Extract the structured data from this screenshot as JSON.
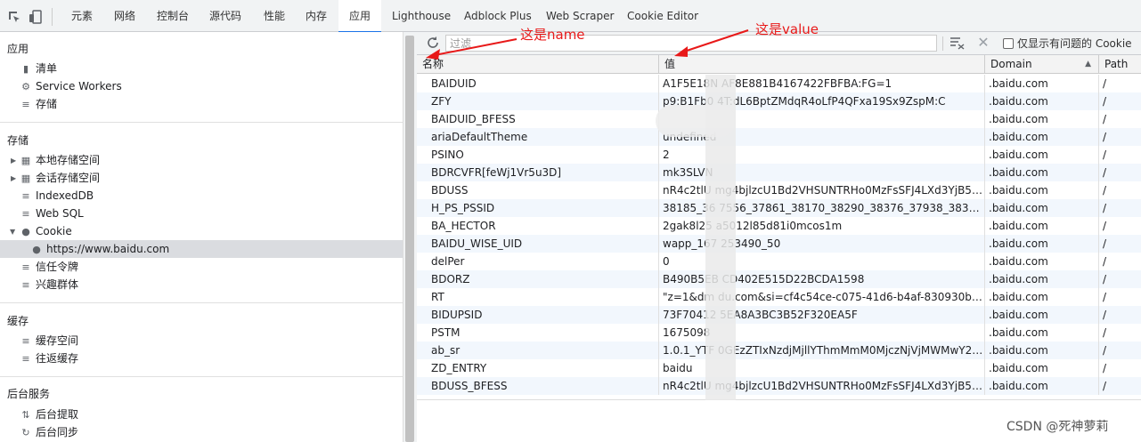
{
  "tabs": [
    {
      "label": "元素"
    },
    {
      "label": "网络"
    },
    {
      "label": "控制台"
    },
    {
      "label": "源代码"
    },
    {
      "label": "性能"
    },
    {
      "label": "内存"
    },
    {
      "label": "应用"
    },
    {
      "label": "Lighthouse"
    },
    {
      "label": "Adblock Plus"
    },
    {
      "label": "Web Scraper"
    },
    {
      "label": "Cookie Editor"
    }
  ],
  "sidebar": {
    "app_title": "应用",
    "app_items": [
      "清单",
      "Service Workers",
      "存储"
    ],
    "storage_title": "存储",
    "storage_items": [
      "本地存储空间",
      "会话存储空间",
      "IndexedDB",
      "Web SQL",
      "Cookie"
    ],
    "cookie_child": "https://www.baidu.com",
    "storage_items2": [
      "信任令牌",
      "兴趣群体"
    ],
    "cache_title": "缓存",
    "cache_items": [
      "缓存空间",
      "往返缓存"
    ],
    "bg_title": "后台服务",
    "bg_items": [
      "后台提取",
      "后台同步"
    ]
  },
  "toolbar": {
    "filter_placeholder": "过滤",
    "only_issues_label": "仅显示有问题的 Cookie"
  },
  "table": {
    "headers": {
      "name": "名称",
      "value": "值",
      "domain": "Domain",
      "path": "Path"
    },
    "rows": [
      {
        "name": "BAIDUID",
        "value": "A1F5E18N        AF8E881B4167422FBFBA:FG=1",
        "domain": ".baidu.com",
        "path": "/"
      },
      {
        "name": "ZFY",
        "value": "p9:B1Fb0         4T:dL6BptZMdqR4oLfP4QFxa19Sx9ZspM:C",
        "domain": ".baidu.com",
        "path": "/"
      },
      {
        "name": "BAIDUID_BFESS",
        "value": "",
        "domain": ".baidu.com",
        "path": "/"
      },
      {
        "name": "ariaDefaultTheme",
        "value": "undefined",
        "domain": ".baidu.com",
        "path": "/"
      },
      {
        "name": "PSINO",
        "value": "2",
        "domain": ".baidu.com",
        "path": "/"
      },
      {
        "name": "BDRCVFR[feWj1Vr5u3D]",
        "value": "mk3SLVN",
        "domain": ".baidu.com",
        "path": "/"
      },
      {
        "name": "BDUSS",
        "value": "nR4c2tlU         mg4bjlzcU1Bd2VHSUNTRHo0MzFsSFJ4LXd3YjB5b...",
        "domain": ".baidu.com",
        "path": "/"
      },
      {
        "name": "H_PS_PSSID",
        "value": "38185_36        7556_37861_38170_38290_38376_37938_38314_3...",
        "domain": ".baidu.com",
        "path": "/"
      },
      {
        "name": "BA_HECTOR",
        "value": "2gak8l25        a5012l85d81i0mcos1m",
        "domain": ".baidu.com",
        "path": "/"
      },
      {
        "name": "BAIDU_WISE_UID",
        "value": "wapp_167        253490_50",
        "domain": ".baidu.com",
        "path": "/"
      },
      {
        "name": "delPer",
        "value": "0",
        "domain": ".baidu.com",
        "path": "/"
      },
      {
        "name": "BDORZ",
        "value": "B490B5EB        CD402E515D22BCDA1598",
        "domain": ".baidu.com",
        "path": "/"
      },
      {
        "name": "RT",
        "value": "\"z=1&dm        du.com&si=cf4c54ce-c075-41d6-b4af-830930b350...",
        "domain": ".baidu.com",
        "path": "/"
      },
      {
        "name": "BIDUPSID",
        "value": "73F70412        5EA8A3BC3B52F320EA5F",
        "domain": ".baidu.com",
        "path": "/"
      },
      {
        "name": "PSTM",
        "value": "1675098",
        "domain": ".baidu.com",
        "path": "/"
      },
      {
        "name": "ab_sr",
        "value": "1.0.1_YTF        0GEzZTIxNzdjMjllYThmMmM0MjczNjVjMWMwY2Z...",
        "domain": ".baidu.com",
        "path": "/"
      },
      {
        "name": "ZD_ENTRY",
        "value": "baidu",
        "domain": ".baidu.com",
        "path": "/"
      },
      {
        "name": "BDUSS_BFESS",
        "value": "nR4c2tlU         mg4bjlzcU1Bd2VHSUNTRHo0MzFsSFJ4LXd3YjB5b...",
        "domain": ".baidu.com",
        "path": "/"
      }
    ]
  },
  "annotations": {
    "name_label": "这是name",
    "value_label": "这是value",
    "color": "#e81919"
  },
  "watermark": "CSDN @死神萝莉"
}
